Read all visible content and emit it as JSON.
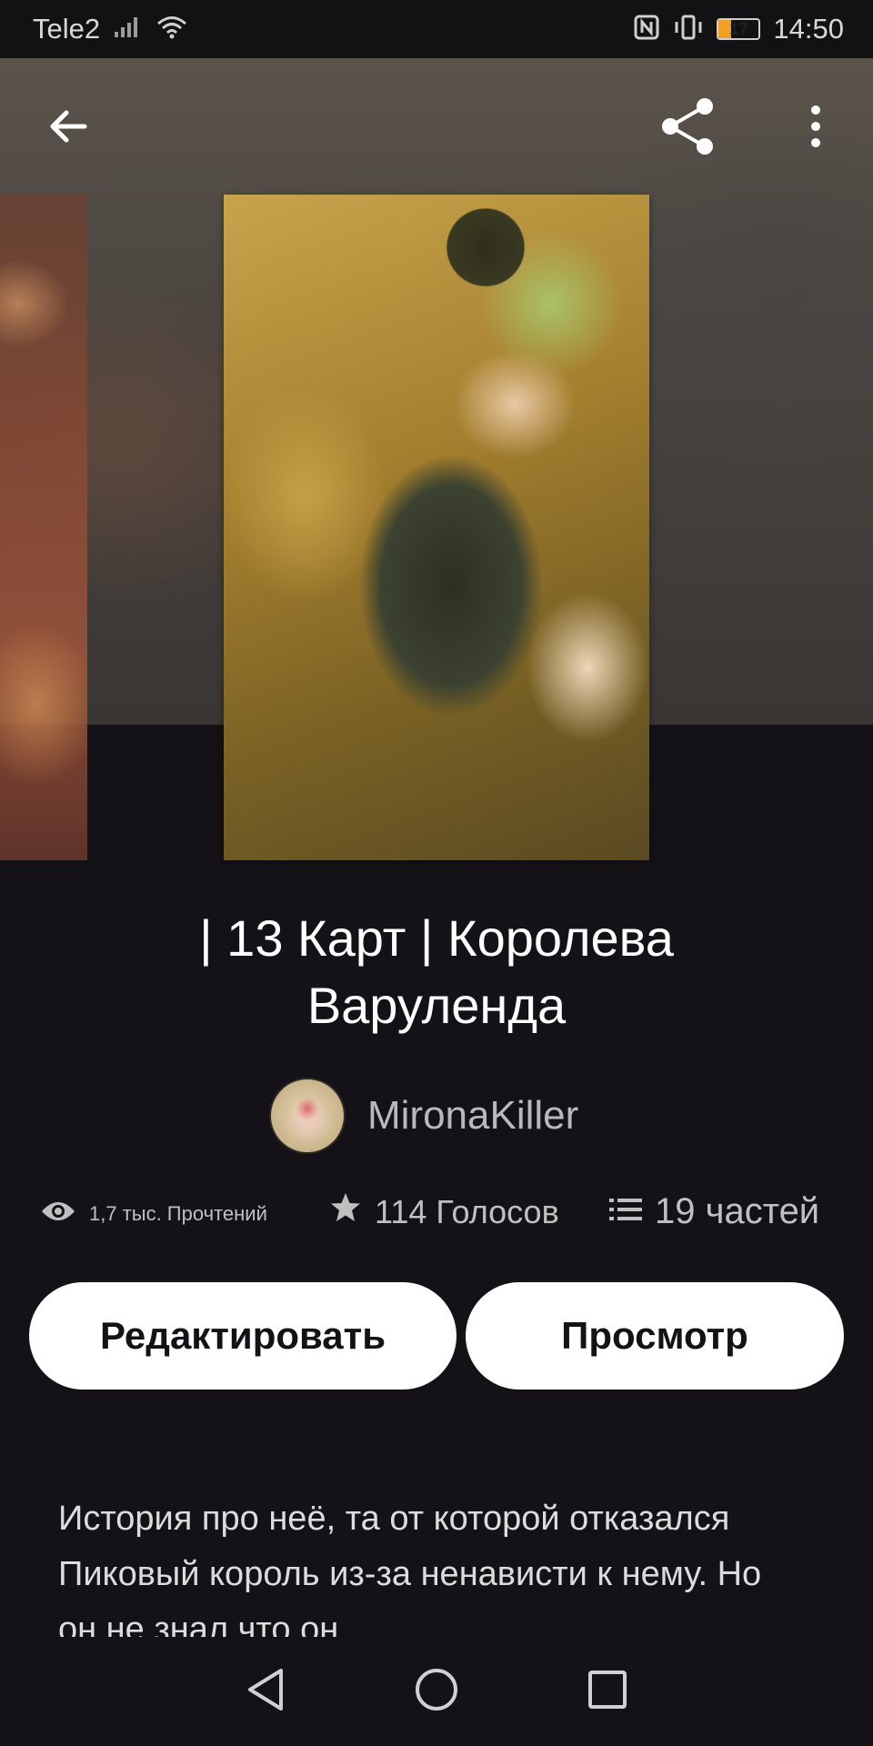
{
  "status_bar": {
    "carrier": "Tele2",
    "battery": "17",
    "time": "14:50",
    "icons": [
      "signal-icon",
      "wifi-icon",
      "nfc-icon",
      "vibrate-icon",
      "battery-icon"
    ]
  },
  "toolbar": {
    "icons": [
      "back-arrow-icon",
      "share-icon",
      "more-vert-icon"
    ]
  },
  "story": {
    "title": "| 13 Карт | Королева Варуленда",
    "author": "MironaKiller",
    "reads": "1,7 тыс. Прочтений",
    "votes": "114 Голосов",
    "parts": "19 частей",
    "description": "История про неё, та от которой отказался Пиковый король из-за ненависти к нему. Но он не знал что он"
  },
  "actions": {
    "edit_label": "Редактировать",
    "view_label": "Просмотр"
  },
  "nav": {
    "icons": [
      "nav-back-icon",
      "nav-home-icon",
      "nav-recents-icon"
    ]
  },
  "colors": {
    "background": "#141216",
    "button_bg": "#ffffff",
    "muted_text": "#c0c0c0",
    "battery_accent": "#f0a024"
  }
}
